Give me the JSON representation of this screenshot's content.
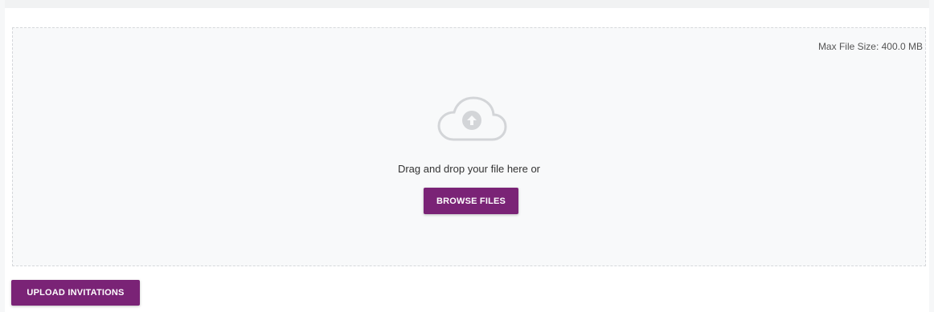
{
  "upload": {
    "max_file_size": "Max File Size: 400.0 MB",
    "drop_text": "Drag and drop your file here or",
    "browse_label": "BROWSE FILES",
    "upload_label": "UPLOAD INVITATIONS",
    "icon": "cloud-upload-icon"
  },
  "colors": {
    "accent": "#7a2376",
    "dropzone_bg": "#f8f9fa",
    "border": "#d6d8db",
    "icon": "#d3d5d8"
  }
}
